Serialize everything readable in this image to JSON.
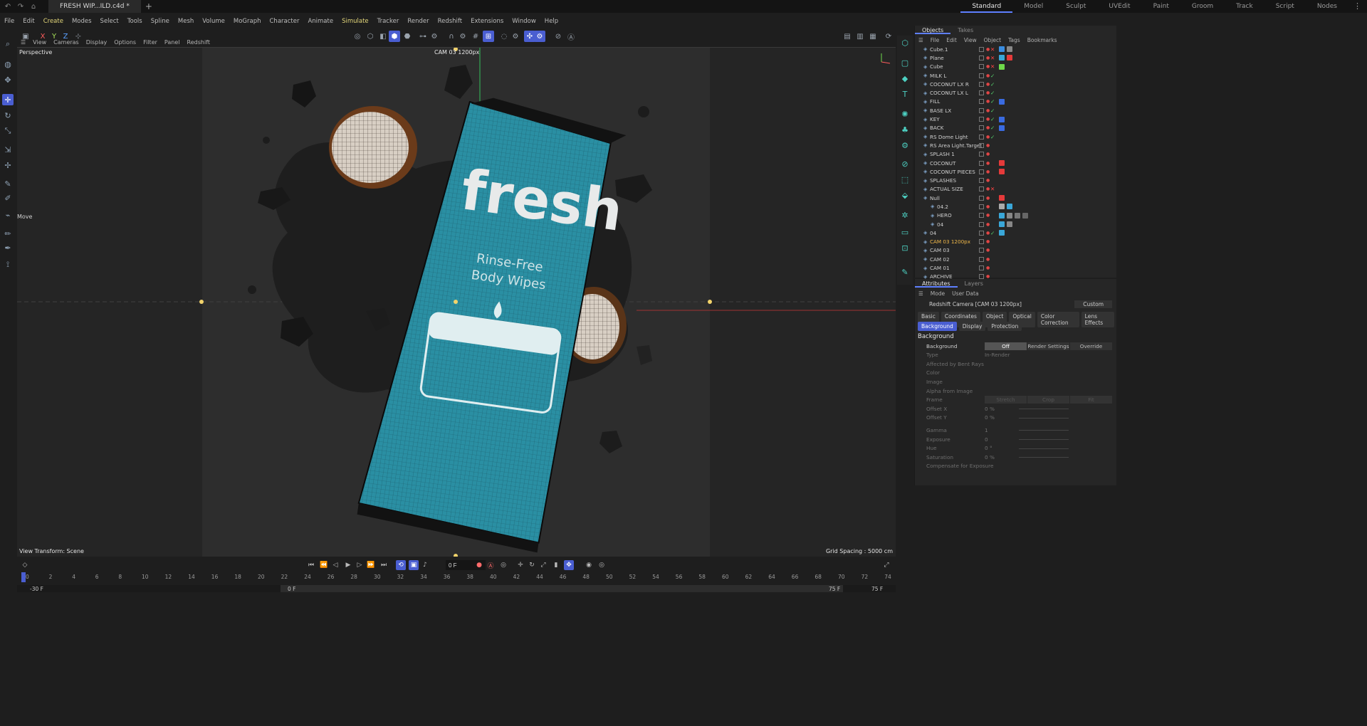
{
  "window": {
    "doc_tab": "FRESH WIP...ILD.c4d *",
    "layouts": [
      "Standard",
      "Model",
      "Sculpt",
      "UVEdit",
      "Paint",
      "Groom",
      "Track",
      "Script",
      "Nodes"
    ],
    "active_layout": "Standard"
  },
  "menu": [
    "File",
    "Edit",
    "Create",
    "Modes",
    "Select",
    "Tools",
    "Spline",
    "Mesh",
    "Volume",
    "MoGraph",
    "Character",
    "Animate",
    "Simulate",
    "Tracker",
    "Render",
    "Redshift",
    "Extensions",
    "Window",
    "Help"
  ],
  "axis_buttons": {
    "x": "X",
    "y": "Y",
    "z": "Z"
  },
  "viewport": {
    "menu": [
      "View",
      "Cameras",
      "Display",
      "Options",
      "Filter",
      "Panel",
      "Redshift"
    ],
    "label": "Perspective",
    "camera_label": "CAM 03 1200px",
    "view_transform": "View Transform: Scene",
    "grid_spacing": "Grid Spacing : 5000 cm",
    "tool_label": "Move",
    "package_text": {
      "brand": "fresh",
      "line1": "Rinse-Free",
      "line2": "Body Wipes"
    }
  },
  "objects_panel": {
    "tabs": [
      "Objects",
      "Takes"
    ],
    "menu": [
      "File",
      "Edit",
      "View",
      "Object",
      "Tags",
      "Bookmarks"
    ],
    "rows": [
      {
        "name": "Cube.1",
        "indent": 0,
        "state": "x",
        "tags": [
          "#3a8de0",
          "#888"
        ]
      },
      {
        "name": "Plane",
        "indent": 0,
        "state": "x",
        "tags": [
          "#3aa7d8",
          "#e53a3a"
        ]
      },
      {
        "name": "Cube",
        "indent": 0,
        "state": "x",
        "tags": [
          "#6fd94a"
        ]
      },
      {
        "name": "MILK L",
        "indent": 0,
        "state": "ok",
        "tags": []
      },
      {
        "name": "COCONUT LX R",
        "indent": 0,
        "state": "ok",
        "tags": []
      },
      {
        "name": "COCONUT LX L",
        "indent": 0,
        "state": "ok",
        "tags": []
      },
      {
        "name": "FILL",
        "indent": 0,
        "state": "ok",
        "tags": [
          "#3a6be0"
        ]
      },
      {
        "name": "BASE LX",
        "indent": 0,
        "state": "ok",
        "tags": []
      },
      {
        "name": "KEY",
        "indent": 0,
        "state": "ok",
        "tags": [
          "#3a6be0"
        ]
      },
      {
        "name": "BACK",
        "indent": 0,
        "state": "ok",
        "tags": [
          "#3a6be0"
        ]
      },
      {
        "name": "RS Dome Light",
        "indent": 0,
        "state": "ok",
        "tags": []
      },
      {
        "name": "RS Area Light.Target",
        "indent": 0,
        "state": "",
        "tags": []
      },
      {
        "name": "SPLASH 1",
        "indent": 0,
        "state": "",
        "tags": []
      },
      {
        "name": "COCONUT",
        "indent": 0,
        "state": "",
        "tags": [
          "#e53a3a"
        ]
      },
      {
        "name": "COCONUT PIECES",
        "indent": 0,
        "state": "",
        "tags": [
          "#e53a3a"
        ]
      },
      {
        "name": "SPLASHES",
        "indent": 0,
        "state": "",
        "tags": []
      },
      {
        "name": "ACTUAL SIZE",
        "indent": 0,
        "state": "x",
        "tags": []
      },
      {
        "name": "Null",
        "indent": 0,
        "state": "",
        "tags": [
          "#e53a3a"
        ]
      },
      {
        "name": "04.2",
        "indent": 1,
        "state": "",
        "tags": [
          "#aaa",
          "#3aa7d8"
        ]
      },
      {
        "name": "HERO",
        "indent": 1,
        "state": "",
        "tags": [
          "#3aa7d8",
          "#888",
          "#777",
          "#666"
        ]
      },
      {
        "name": "04",
        "indent": 1,
        "state": "",
        "tags": [
          "#3aa7d8",
          "#888"
        ]
      },
      {
        "name": "04",
        "indent": 0,
        "state": "ok",
        "tags": [
          "#3aa7d8"
        ]
      },
      {
        "name": "CAM 03 1200px",
        "indent": 0,
        "state": "",
        "tags": [],
        "highlight": true
      },
      {
        "name": "CAM 03",
        "indent": 0,
        "state": "",
        "tags": []
      },
      {
        "name": "CAM 02",
        "indent": 0,
        "state": "",
        "tags": []
      },
      {
        "name": "CAM 01",
        "indent": 0,
        "state": "",
        "tags": []
      },
      {
        "name": "ARCHIVE",
        "indent": 0,
        "state": "",
        "tags": []
      }
    ]
  },
  "attributes": {
    "tabs": [
      "Attributes",
      "Layers"
    ],
    "menu": [
      "Mode",
      "User Data"
    ],
    "title": "Redshift Camera [CAM 03 1200px]",
    "preset": "Custom",
    "subtabs_row1": [
      "Basic",
      "Coordinates",
      "Object",
      "Optical",
      "Color Correction",
      "Lens Effects"
    ],
    "subtabs_row2": [
      "Background",
      "Display",
      "Protection"
    ],
    "active_subtab": "Background",
    "section": "Background",
    "background_modes": [
      "Off",
      "Render Settings",
      "Override"
    ],
    "active_mode": "Off",
    "type_value": "In-Render",
    "frame_modes": [
      "Stretch",
      "Crop",
      "Fit"
    ],
    "props": [
      {
        "label": "Background",
        "value": "",
        "enabled": true
      },
      {
        "label": "Type",
        "value": "In-Render"
      },
      {
        "label": "Affected by Bent Rays",
        "value": ""
      },
      {
        "label": "Color",
        "value": ""
      },
      {
        "label": "Image",
        "value": ""
      },
      {
        "label": "Alpha from Image",
        "value": ""
      },
      {
        "label": "Frame",
        "value": ""
      },
      {
        "label": "Offset X",
        "value": "0 %"
      },
      {
        "label": "Offset Y",
        "value": "0 %"
      },
      {
        "label": "Gamma",
        "value": "1"
      },
      {
        "label": "Exposure",
        "value": "0"
      },
      {
        "label": "Hue",
        "value": "0 °"
      },
      {
        "label": "Saturation",
        "value": "0 %"
      },
      {
        "label": "Compensate for Exposure",
        "value": ""
      }
    ]
  },
  "timeline": {
    "current_frame": "0 F",
    "ticks": [
      "0",
      "2",
      "4",
      "6",
      "8",
      "10",
      "12",
      "14",
      "16",
      "18",
      "20",
      "22",
      "24",
      "26",
      "28",
      "30",
      "32",
      "34",
      "36",
      "38",
      "40",
      "42",
      "44",
      "46",
      "48",
      "50",
      "52",
      "54",
      "56",
      "58",
      "60",
      "62",
      "64",
      "66",
      "68",
      "70",
      "72",
      "74"
    ],
    "range_start": "-30 F",
    "range_min": "0 F",
    "range_max": "75 F",
    "range_end": "75 F"
  },
  "colors": {
    "accent": "#4a5ed1",
    "package": "#2a8fa3",
    "highlight_text": "#f0b84a"
  }
}
